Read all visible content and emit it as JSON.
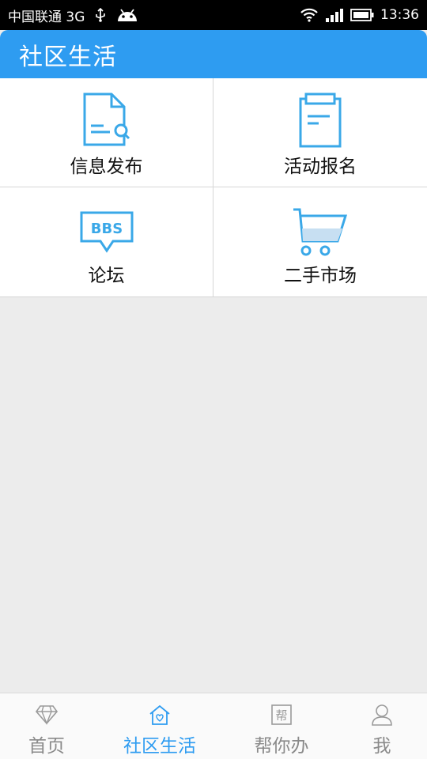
{
  "status_bar": {
    "carrier": "中国联通 3G",
    "time": "13:36"
  },
  "header": {
    "title": "社区生活"
  },
  "grid": {
    "items": [
      {
        "label": "信息发布",
        "icon": "document-search-icon"
      },
      {
        "label": "活动报名",
        "icon": "clipboard-icon"
      },
      {
        "label": "论坛",
        "icon": "bbs-icon",
        "icon_text": "BBS"
      },
      {
        "label": "二手市场",
        "icon": "shopping-cart-icon"
      }
    ]
  },
  "bottom_nav": {
    "items": [
      {
        "label": "首页",
        "icon": "diamond-icon",
        "active": false
      },
      {
        "label": "社区生活",
        "icon": "home-heart-icon",
        "active": true
      },
      {
        "label": "帮你办",
        "icon": "help-badge-icon",
        "icon_text": "帮",
        "active": false
      },
      {
        "label": "我",
        "icon": "user-icon",
        "active": false
      }
    ]
  },
  "colors": {
    "accent": "#2e9cf1",
    "icon_blue": "#3aa8e8",
    "background": "#ececec",
    "inactive": "#8a8a8a"
  }
}
